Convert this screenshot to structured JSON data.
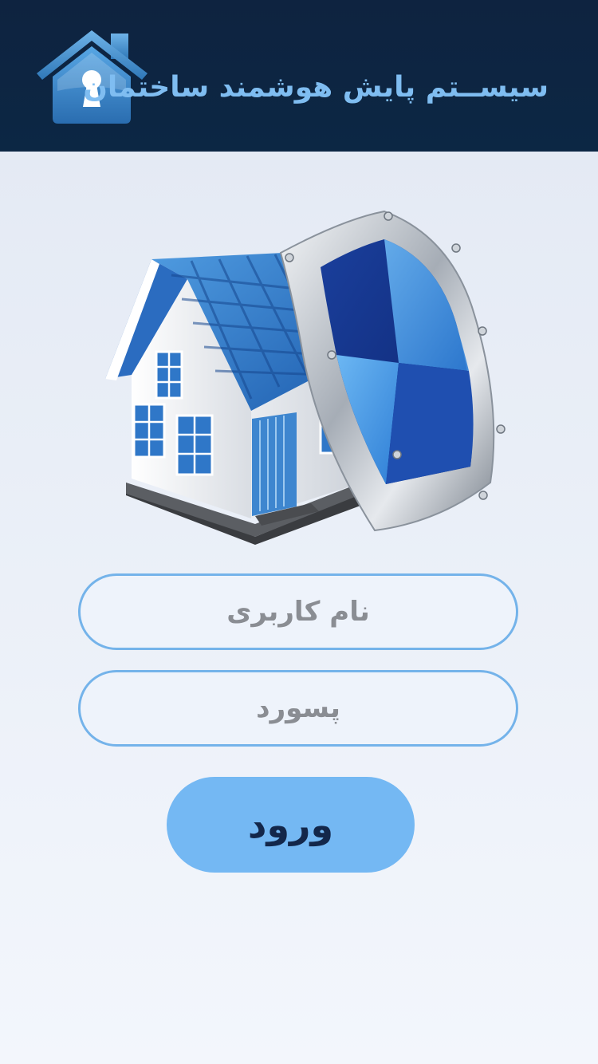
{
  "header": {
    "title": "سیســتم پایش هوشمند ساختمان",
    "logo_icon": "house-keyhole-icon"
  },
  "hero": {
    "illustration": "house-shield-icon"
  },
  "form": {
    "username": {
      "placeholder": "نام کاربری",
      "value": ""
    },
    "password": {
      "placeholder": "پسورد",
      "value": ""
    },
    "login_label": "ورود"
  },
  "colors": {
    "header_bg": "#0e2340",
    "title": "#7fbdf1",
    "field_border": "#74b3ea",
    "button_bg": "#74b8f3",
    "button_text": "#13274a",
    "placeholder": "#8a8d93"
  }
}
